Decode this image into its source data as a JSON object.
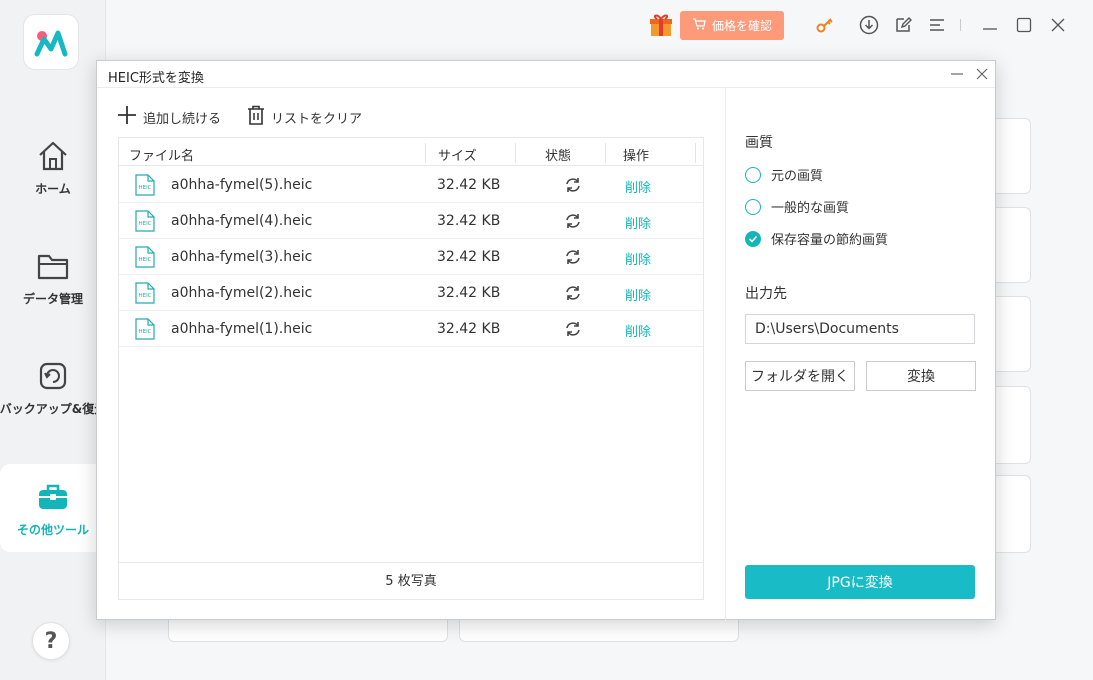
{
  "app": {
    "brand_color": "#14b5b8",
    "logo_icon": "app-logo"
  },
  "sidebar": {
    "items": [
      {
        "label": "ホーム",
        "icon": "home-icon"
      },
      {
        "label": "データ管理",
        "icon": "folder-icon"
      },
      {
        "label": "バックアップ&復元",
        "icon": "backup-icon"
      },
      {
        "label": "その他ツール",
        "icon": "toolbox-icon",
        "active": true
      }
    ],
    "help_label": "?"
  },
  "topbar": {
    "price_label": "価格を確認",
    "icons": [
      "gift-icon",
      "cart-icon",
      "key-icon",
      "download-icon",
      "edit-icon",
      "menu-icon",
      "minimize-icon",
      "maximize-icon",
      "close-icon"
    ]
  },
  "dialog": {
    "title": "HEIC形式を変換",
    "add_label": "追加し続ける",
    "clear_label": "リストをクリア",
    "columns": {
      "name": "ファイル名",
      "size": "サイズ",
      "status": "状態",
      "action": "操作"
    },
    "files": [
      {
        "name": "a0hha-fymel(5).heic",
        "size": "32.42 KB",
        "action": "削除"
      },
      {
        "name": "a0hha-fymel(4).heic",
        "size": "32.42 KB",
        "action": "削除"
      },
      {
        "name": "a0hha-fymel(3).heic",
        "size": "32.42 KB",
        "action": "削除"
      },
      {
        "name": "a0hha-fymel(2).heic",
        "size": "32.42 KB",
        "action": "削除"
      },
      {
        "name": "a0hha-fymel(1).heic",
        "size": "32.42 KB",
        "action": "削除"
      }
    ],
    "file_icon_text": "HEIC",
    "footer": "5 枚写真",
    "quality": {
      "heading": "画質",
      "options": [
        "元の画質",
        "一般的な画質",
        "保存容量の節約画質"
      ],
      "selected_index": 2
    },
    "output": {
      "heading": "出力先",
      "path": "D:\\Users\\Documents",
      "open_folder_label": "フォルダを開く",
      "change_label": "変換"
    },
    "convert_label": "JPGに変換"
  }
}
